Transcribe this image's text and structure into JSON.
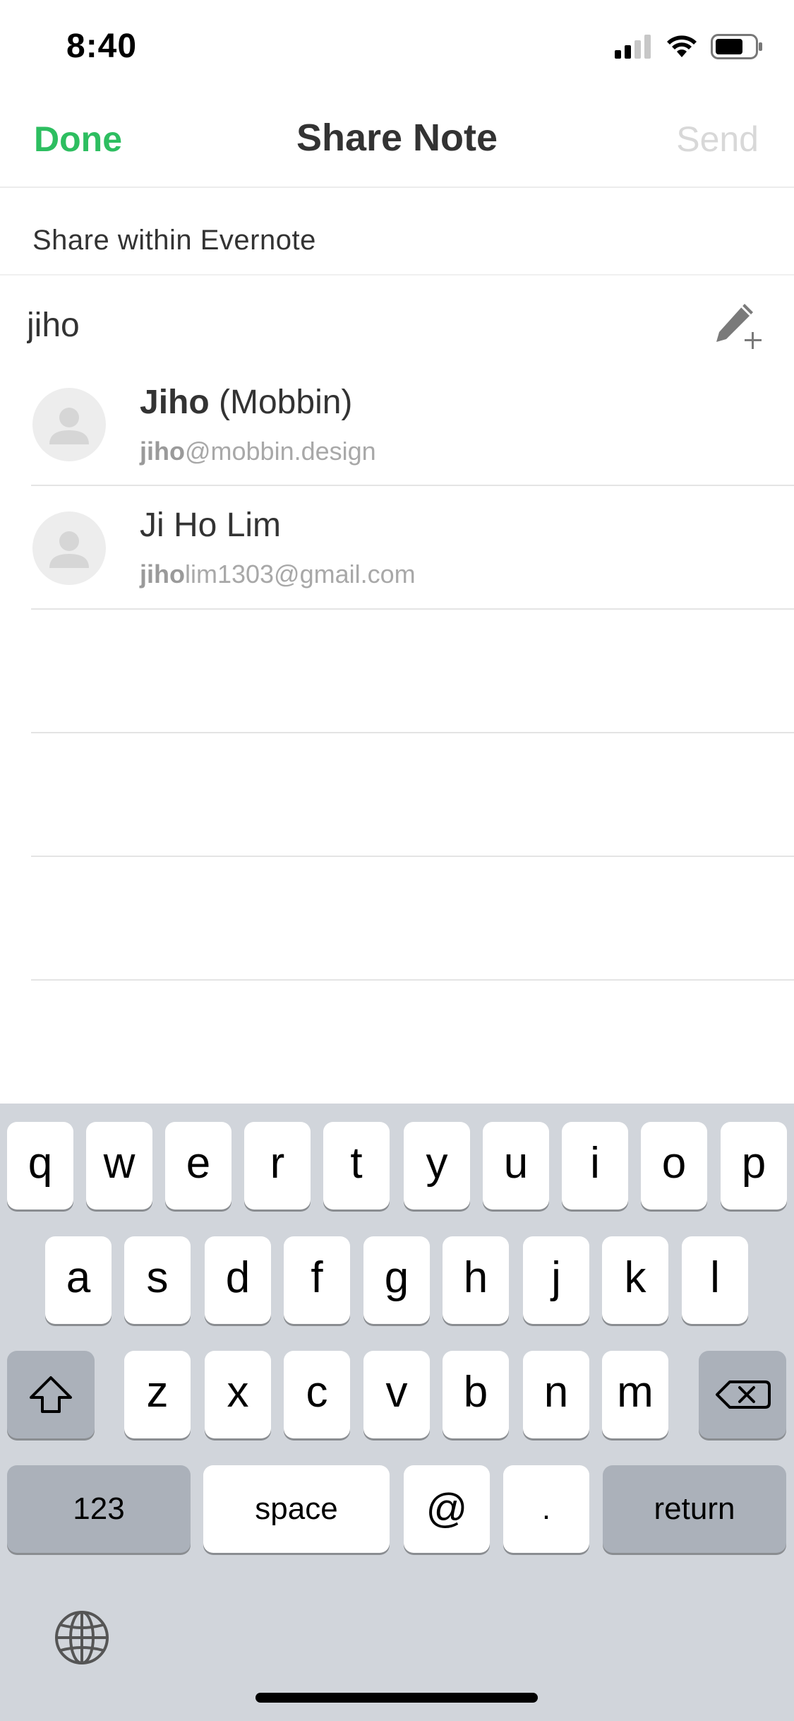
{
  "status_bar": {
    "time": "8:40",
    "icons": [
      "signal-icon",
      "wifi-icon",
      "battery-icon"
    ]
  },
  "nav": {
    "done_label": "Done",
    "title": "Share Note",
    "send_label": "Send"
  },
  "section": {
    "header": "Share within Evernote"
  },
  "search": {
    "value": "jiho"
  },
  "contacts": [
    {
      "name_match": "Jiho",
      "name_rest": " (Mobbin)",
      "email_match": "jiho",
      "email_rest": "@mobbin.design"
    },
    {
      "name_match": "",
      "name_rest": "Ji Ho Lim",
      "email_match": "jiho",
      "email_rest": "lim1303@gmail.com"
    }
  ],
  "keyboard": {
    "row1": [
      "q",
      "w",
      "e",
      "r",
      "t",
      "y",
      "u",
      "i",
      "o",
      "p"
    ],
    "row2": [
      "a",
      "s",
      "d",
      "f",
      "g",
      "h",
      "j",
      "k",
      "l"
    ],
    "row3": [
      "z",
      "x",
      "c",
      "v",
      "b",
      "n",
      "m"
    ],
    "numbers_label": "123",
    "space_label": "space",
    "at_label": "@",
    "period_label": ".",
    "return_label": "return"
  },
  "colors": {
    "accent": "#2dbe60",
    "disabled": "#d8d8d8",
    "keyboard_bg": "#d1d5db"
  }
}
